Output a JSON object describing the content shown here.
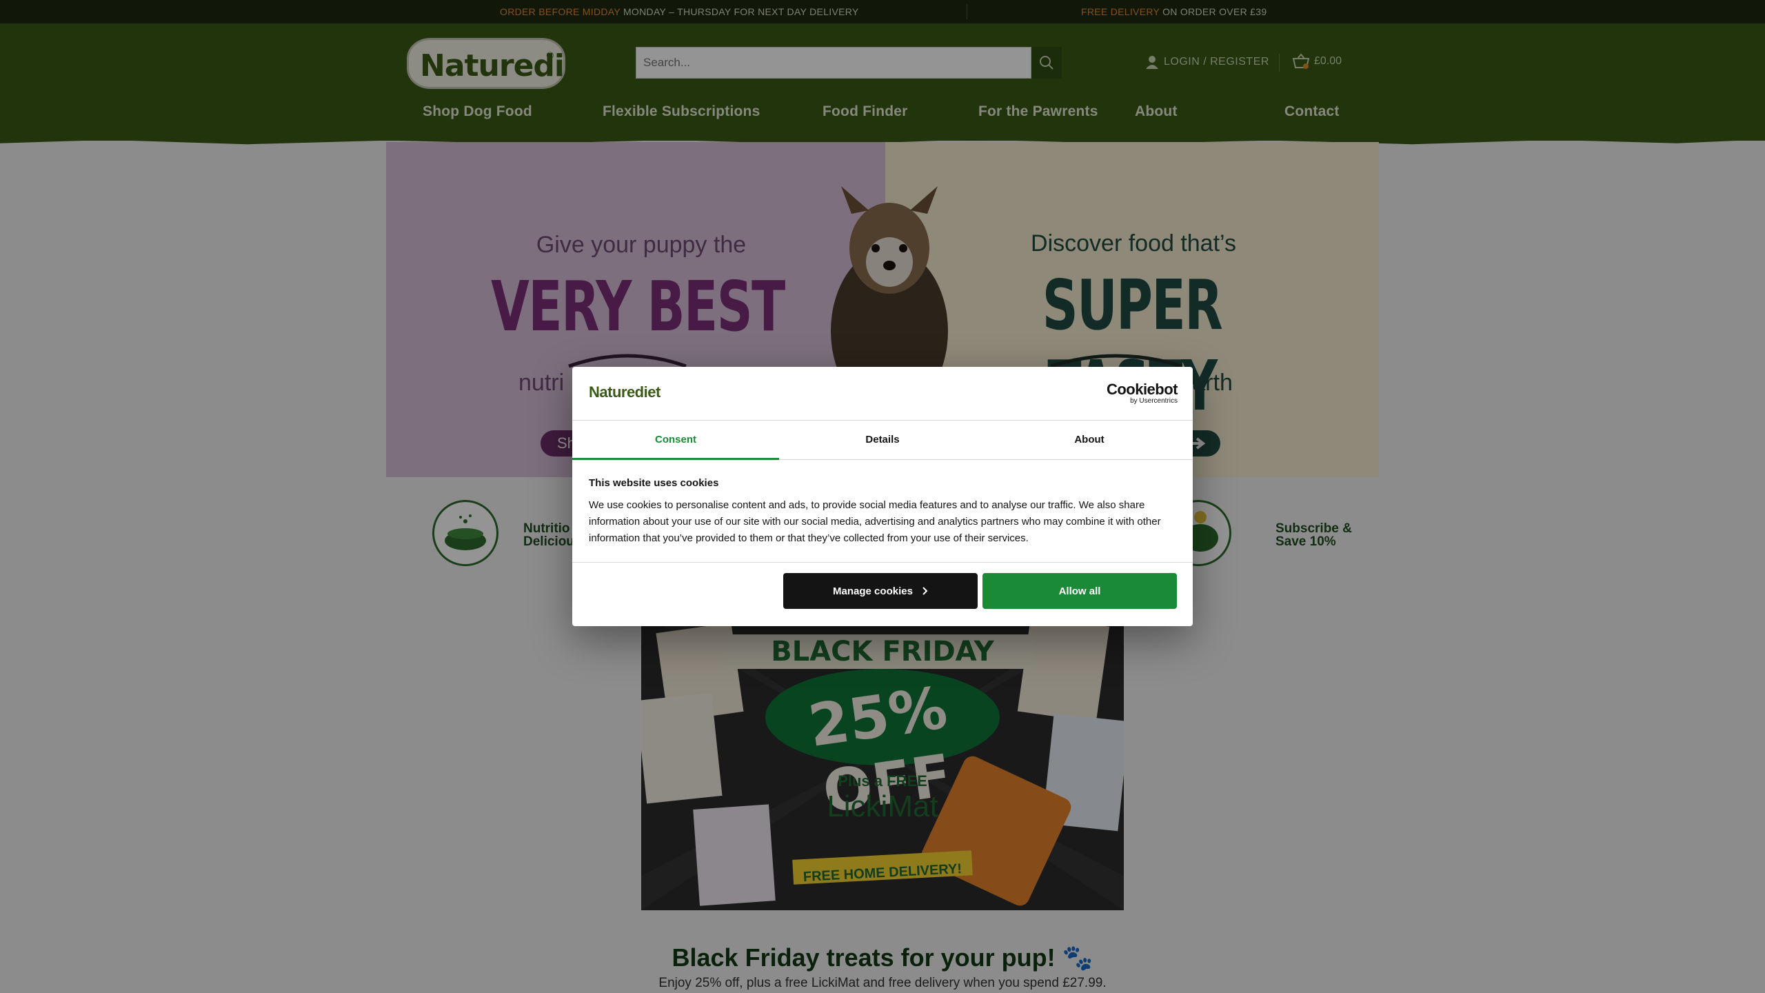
{
  "topbar": {
    "msg1_highlight": "ORDER BEFORE MIDDAY",
    "msg1_text": "MONDAY – THURSDAY FOR NEXT DAY DELIVERY",
    "msg2_highlight": "FREE DELIVERY",
    "msg2_text": "ON ORDER OVER £39"
  },
  "header": {
    "logo": "Naturediet",
    "search_placeholder": "Search...",
    "account_label": "LOGIN / REGISTER",
    "cart_total": "£0.00",
    "cart_count": "0"
  },
  "nav": [
    "Shop Dog Food",
    "Flexible Subscriptions",
    "Food Finder",
    "For the Pawrents",
    "About",
    "Contact"
  ],
  "hero": {
    "left_line1": "Give your puppy the",
    "left_big": "VERY BEST",
    "left_line3": "nutri",
    "left_btn": "Sh",
    "right_line1": "Discover food that’s",
    "right_big": "SUPER TASTY",
    "right_line3": "e earth"
  },
  "features": {
    "f1_line1": "Nutritio",
    "f1_line2": "Deliciou",
    "f4_line1": "Subscribe &",
    "f4_line2": "Save 10%"
  },
  "promo": {
    "banner_heading": "BLACK FRIDAY",
    "banner_offer": "25% OFF",
    "banner_plus": "Plus a FREE",
    "banner_brand": "LickiMat",
    "banner_delivery": "FREE HOME DELIVERY!",
    "title": "Black Friday treats for your pup! 🐾",
    "subtitle": "Enjoy 25% off, plus a free LickiMat and free delivery when you spend £27.99."
  },
  "cookie_dialog": {
    "logo": "Naturediet",
    "brand": "Cookiebot",
    "brand_sub": "by Usercentrics",
    "tabs": [
      "Consent",
      "Details",
      "About"
    ],
    "heading": "This website uses cookies",
    "body": "We use cookies to personalise content and ads, to provide social media features and to analyse our traffic. We also share information about your use of our site with our social media, advertising and analytics partners who may combine it with other information that you’ve provided to them or that they’ve collected from your use of their services.",
    "manage_label": "Manage cookies",
    "allow_label": "Allow all"
  },
  "colors": {
    "header_green": "#3a5a16",
    "topbar": "#1f2a10",
    "accent_orange": "#e08a2e",
    "cookiebot_green": "#1b8a37"
  }
}
